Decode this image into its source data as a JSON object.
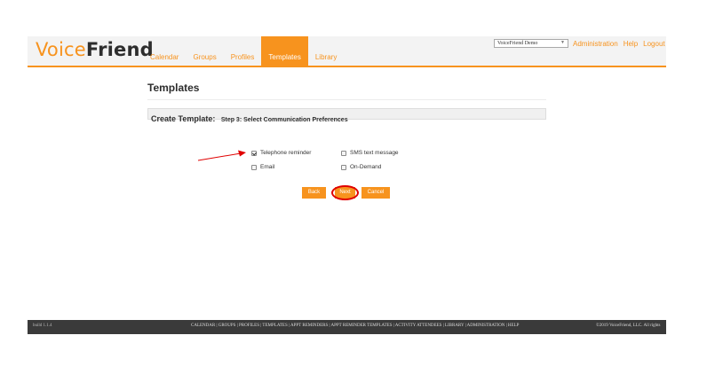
{
  "header": {
    "logo_voice": "Voice",
    "logo_friend": "Friend",
    "nav_tabs": [
      {
        "label": "Calendar"
      },
      {
        "label": "Groups"
      },
      {
        "label": "Profiles"
      },
      {
        "label": "Templates",
        "active": true
      },
      {
        "label": "Library"
      }
    ],
    "account_select_value": "VoiceFriend Demo",
    "top_links": {
      "administration": "Administration",
      "help": "Help",
      "logout": "Logout"
    }
  },
  "main": {
    "page_title": "Templates",
    "step_title": "Create Template:",
    "step_subtitle": "Step 3: Select Communication Preferences",
    "options": {
      "telephone": {
        "label": "Telephone reminder",
        "checked": true
      },
      "sms": {
        "label": "SMS text message",
        "checked": false
      },
      "email": {
        "label": "Email",
        "checked": false
      },
      "on_demand": {
        "label": "On-Demand",
        "checked": false
      }
    },
    "buttons": {
      "back": "Back",
      "next": "Next",
      "cancel": "Cancel"
    }
  },
  "footer": {
    "build": "build 1.1.4",
    "links": "CALENDAR | GROUPS | PROFILES | TEMPLATES | APPT REMINDERS | APPT REMINDER TEMPLATES | ACTIVITY ATTENDEES | LIBRARY | ADMINISTRATION | HELP",
    "copyright": "©2019 VoiceFriend, LLC. All rights"
  },
  "colors": {
    "accent": "#f7931e",
    "annotation": "#e00000",
    "footer_bg": "#3a3a3a"
  }
}
